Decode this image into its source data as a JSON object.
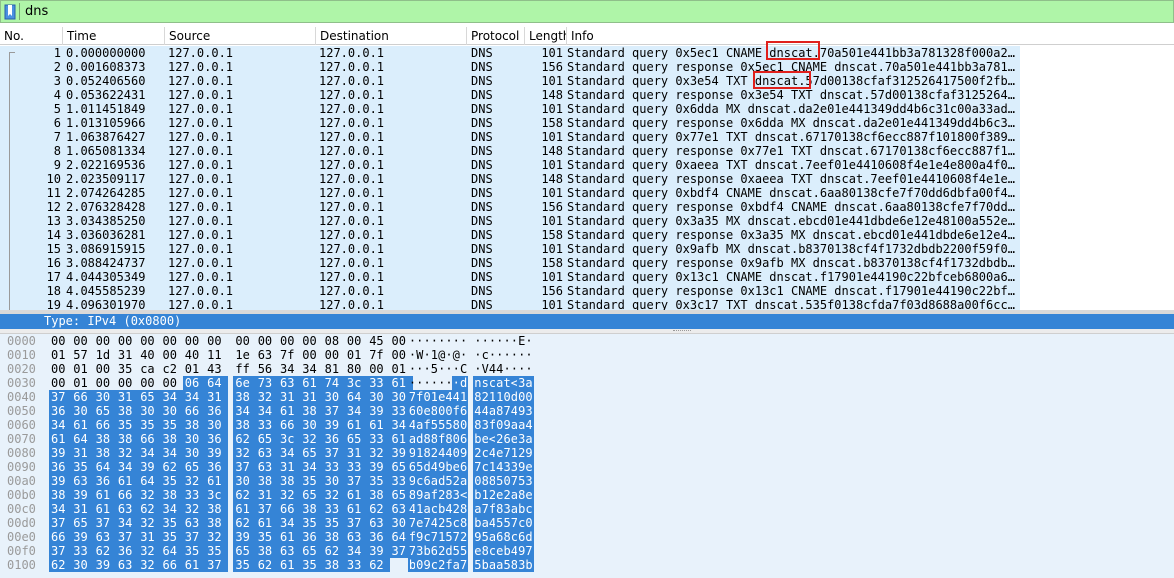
{
  "filter": {
    "value": "dns",
    "bookmark_icon": "bookmark-icon"
  },
  "columns": [
    "No.",
    "Time",
    "Source",
    "Destination",
    "Protocol",
    "Length",
    "Info"
  ],
  "packets": [
    {
      "no": "1",
      "time": "0.000000000",
      "src": "127.0.0.1",
      "dst": "127.0.0.1",
      "proto": "DNS",
      "len": "101",
      "info": "Standard query 0x5ec1 CNAME dnscat.70a501e441bb3a781328f000a2…"
    },
    {
      "no": "2",
      "time": "0.001608373",
      "src": "127.0.0.1",
      "dst": "127.0.0.1",
      "proto": "DNS",
      "len": "156",
      "info": "Standard query response 0x5ec1 CNAME dnscat.70a501e441bb3a781…"
    },
    {
      "no": "3",
      "time": "0.052406560",
      "src": "127.0.0.1",
      "dst": "127.0.0.1",
      "proto": "DNS",
      "len": "101",
      "info": "Standard query 0x3e54 TXT dnscat.57d00138cfaf312526417500f2fb…"
    },
    {
      "no": "4",
      "time": "0.053622431",
      "src": "127.0.0.1",
      "dst": "127.0.0.1",
      "proto": "DNS",
      "len": "148",
      "info": "Standard query response 0x3e54 TXT dnscat.57d00138cfaf3125264…"
    },
    {
      "no": "5",
      "time": "1.011451849",
      "src": "127.0.0.1",
      "dst": "127.0.0.1",
      "proto": "DNS",
      "len": "101",
      "info": "Standard query 0x6dda MX dnscat.da2e01e441349dd4b6c31c00a33ad…"
    },
    {
      "no": "6",
      "time": "1.013105966",
      "src": "127.0.0.1",
      "dst": "127.0.0.1",
      "proto": "DNS",
      "len": "158",
      "info": "Standard query response 0x6dda MX dnscat.da2e01e441349dd4b6c3…"
    },
    {
      "no": "7",
      "time": "1.063876427",
      "src": "127.0.0.1",
      "dst": "127.0.0.1",
      "proto": "DNS",
      "len": "101",
      "info": "Standard query 0x77e1 TXT dnscat.67170138cf6ecc887f101800f389…"
    },
    {
      "no": "8",
      "time": "1.065081334",
      "src": "127.0.0.1",
      "dst": "127.0.0.1",
      "proto": "DNS",
      "len": "148",
      "info": "Standard query response 0x77e1 TXT dnscat.67170138cf6ecc887f1…"
    },
    {
      "no": "9",
      "time": "2.022169536",
      "src": "127.0.0.1",
      "dst": "127.0.0.1",
      "proto": "DNS",
      "len": "101",
      "info": "Standard query 0xaeea TXT dnscat.7eef01e4410608f4e1e4e800a4f0…"
    },
    {
      "no": "10",
      "time": "2.023509117",
      "src": "127.0.0.1",
      "dst": "127.0.0.1",
      "proto": "DNS",
      "len": "148",
      "info": "Standard query response 0xaeea TXT dnscat.7eef01e4410608f4e1e…"
    },
    {
      "no": "11",
      "time": "2.074264285",
      "src": "127.0.0.1",
      "dst": "127.0.0.1",
      "proto": "DNS",
      "len": "101",
      "info": "Standard query 0xbdf4 CNAME dnscat.6aa80138cfe7f70dd6dbfa00f4…"
    },
    {
      "no": "12",
      "time": "2.076328428",
      "src": "127.0.0.1",
      "dst": "127.0.0.1",
      "proto": "DNS",
      "len": "156",
      "info": "Standard query response 0xbdf4 CNAME dnscat.6aa80138cfe7f70dd…"
    },
    {
      "no": "13",
      "time": "3.034385250",
      "src": "127.0.0.1",
      "dst": "127.0.0.1",
      "proto": "DNS",
      "len": "101",
      "info": "Standard query 0x3a35 MX dnscat.ebcd01e441dbde6e12e48100a552e…"
    },
    {
      "no": "14",
      "time": "3.036036281",
      "src": "127.0.0.1",
      "dst": "127.0.0.1",
      "proto": "DNS",
      "len": "158",
      "info": "Standard query response 0x3a35 MX dnscat.ebcd01e441dbde6e12e4…"
    },
    {
      "no": "15",
      "time": "3.086915915",
      "src": "127.0.0.1",
      "dst": "127.0.0.1",
      "proto": "DNS",
      "len": "101",
      "info": "Standard query 0x9afb MX dnscat.b8370138cf4f1732dbdb2200f59f0…"
    },
    {
      "no": "16",
      "time": "3.088424737",
      "src": "127.0.0.1",
      "dst": "127.0.0.1",
      "proto": "DNS",
      "len": "158",
      "info": "Standard query response 0x9afb MX dnscat.b8370138cf4f1732dbdb…"
    },
    {
      "no": "17",
      "time": "4.044305349",
      "src": "127.0.0.1",
      "dst": "127.0.0.1",
      "proto": "DNS",
      "len": "101",
      "info": "Standard query 0x13c1 CNAME dnscat.f17901e44190c22bfceb6800a6…"
    },
    {
      "no": "18",
      "time": "4.045585239",
      "src": "127.0.0.1",
      "dst": "127.0.0.1",
      "proto": "DNS",
      "len": "156",
      "info": "Standard query response 0x13c1 CNAME dnscat.f17901e44190c22bf…"
    },
    {
      "no": "19",
      "time": "4.096301970",
      "src": "127.0.0.1",
      "dst": "127.0.0.1",
      "proto": "DNS",
      "len": "101",
      "info": "Standard query 0x3c17 TXT dnscat.535f0138cfda7f03d8688a00f6cc…"
    }
  ],
  "detail": {
    "selected_line": "Type: IPv4 (0x0800)"
  },
  "hex_dump": {
    "rows": [
      {
        "offset": "0000",
        "hex": [
          "00",
          "00",
          "00",
          "00",
          "00",
          "00",
          "00",
          "00",
          "00",
          "00",
          "00",
          "00",
          "08",
          "00",
          "45",
          "00"
        ],
        "ascii": "········ ······E·"
      },
      {
        "offset": "0010",
        "hex": [
          "01",
          "57",
          "1d",
          "31",
          "40",
          "00",
          "40",
          "11",
          "1e",
          "63",
          "7f",
          "00",
          "00",
          "01",
          "7f",
          "00"
        ],
        "ascii": "·W·1@·@· ·c······"
      },
      {
        "offset": "0020",
        "hex": [
          "00",
          "01",
          "00",
          "35",
          "ca",
          "c2",
          "01",
          "43",
          "ff",
          "56",
          "34",
          "34",
          "81",
          "80",
          "00",
          "01"
        ],
        "ascii": "···5···C ·V44····"
      },
      {
        "offset": "0030",
        "hex": [
          "00",
          "01",
          "00",
          "00",
          "00",
          "00",
          "06",
          "64",
          "6e",
          "73",
          "63",
          "61",
          "74",
          "3c",
          "33",
          "61"
        ],
        "ascii": "·······d nscat<3a"
      },
      {
        "offset": "0040",
        "hex": [
          "37",
          "66",
          "30",
          "31",
          "65",
          "34",
          "34",
          "31",
          "38",
          "32",
          "31",
          "31",
          "30",
          "64",
          "30",
          "30"
        ],
        "ascii": "7f01e441 82110d00"
      },
      {
        "offset": "0050",
        "hex": [
          "36",
          "30",
          "65",
          "38",
          "30",
          "30",
          "66",
          "36",
          "34",
          "34",
          "61",
          "38",
          "37",
          "34",
          "39",
          "33"
        ],
        "ascii": "60e800f6 44a87493"
      },
      {
        "offset": "0060",
        "hex": [
          "34",
          "61",
          "66",
          "35",
          "35",
          "35",
          "38",
          "30",
          "38",
          "33",
          "66",
          "30",
          "39",
          "61",
          "61",
          "34"
        ],
        "ascii": "4af55580 83f09aa4"
      },
      {
        "offset": "0070",
        "hex": [
          "61",
          "64",
          "38",
          "38",
          "66",
          "38",
          "30",
          "36",
          "62",
          "65",
          "3c",
          "32",
          "36",
          "65",
          "33",
          "61"
        ],
        "ascii": "ad88f806 be<26e3a"
      },
      {
        "offset": "0080",
        "hex": [
          "39",
          "31",
          "38",
          "32",
          "34",
          "34",
          "30",
          "39",
          "32",
          "63",
          "34",
          "65",
          "37",
          "31",
          "32",
          "39"
        ],
        "ascii": "91824409 2c4e7129"
      },
      {
        "offset": "0090",
        "hex": [
          "36",
          "35",
          "64",
          "34",
          "39",
          "62",
          "65",
          "36",
          "37",
          "63",
          "31",
          "34",
          "33",
          "33",
          "39",
          "65"
        ],
        "ascii": "65d49be6 7c14339e"
      },
      {
        "offset": "00a0",
        "hex": [
          "39",
          "63",
          "36",
          "61",
          "64",
          "35",
          "32",
          "61",
          "30",
          "38",
          "38",
          "35",
          "30",
          "37",
          "35",
          "33"
        ],
        "ascii": "9c6ad52a 08850753"
      },
      {
        "offset": "00b0",
        "hex": [
          "38",
          "39",
          "61",
          "66",
          "32",
          "38",
          "33",
          "3c",
          "62",
          "31",
          "32",
          "65",
          "32",
          "61",
          "38",
          "65"
        ],
        "ascii": "89af283< b12e2a8e"
      },
      {
        "offset": "00c0",
        "hex": [
          "34",
          "31",
          "61",
          "63",
          "62",
          "34",
          "32",
          "38",
          "61",
          "37",
          "66",
          "38",
          "33",
          "61",
          "62",
          "63"
        ],
        "ascii": "41acb428 a7f83abc"
      },
      {
        "offset": "00d0",
        "hex": [
          "37",
          "65",
          "37",
          "34",
          "32",
          "35",
          "63",
          "38",
          "62",
          "61",
          "34",
          "35",
          "35",
          "37",
          "63",
          "30"
        ],
        "ascii": "7e7425c8 ba4557c0"
      },
      {
        "offset": "00e0",
        "hex": [
          "66",
          "39",
          "63",
          "37",
          "31",
          "35",
          "37",
          "32",
          "39",
          "35",
          "61",
          "36",
          "38",
          "63",
          "36",
          "64"
        ],
        "ascii": "f9c71572 95a68c6d"
      },
      {
        "offset": "00f0",
        "hex": [
          "37",
          "33",
          "62",
          "36",
          "32",
          "64",
          "35",
          "35",
          "65",
          "38",
          "63",
          "65",
          "62",
          "34",
          "39",
          "37"
        ],
        "ascii": "73b62d55 e8ceb497"
      },
      {
        "offset": "0100",
        "hex": [
          "62",
          "30",
          "39",
          "63",
          "32",
          "66",
          "61",
          "37",
          "35",
          "62",
          "61",
          "35",
          "38",
          "33",
          "62"
        ],
        "ascii": "b09c2fa7 5baa583b"
      }
    ],
    "selection_start_byte": 54
  },
  "colors": {
    "filter_bg": "#aff5a8",
    "row_bg": "#dbeefc",
    "selected_bg": "#3584d6",
    "highlight_box": "#e0201c"
  }
}
